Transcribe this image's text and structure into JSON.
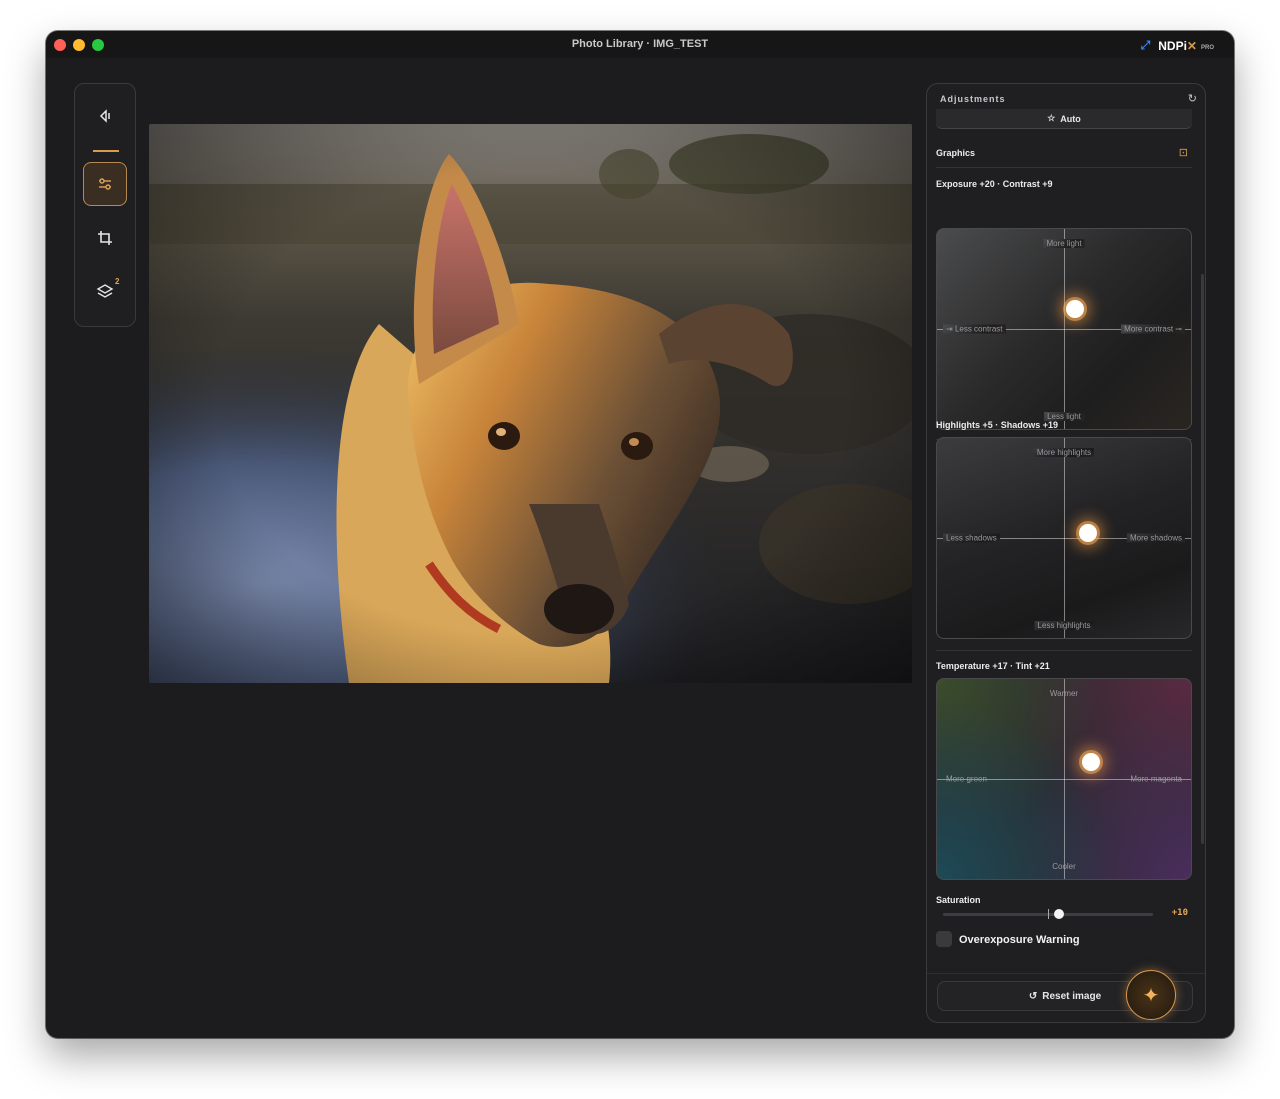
{
  "window": {
    "title": "Photo Library · IMG_TEST",
    "brand": "NDPi",
    "brand_x": "✕",
    "brand_badge": "PRO"
  },
  "toolbar": {
    "layers_badge": "2",
    "tools": [
      "back",
      "adjustments",
      "crop",
      "layers"
    ],
    "active_tool": "adjustments"
  },
  "adjustments": {
    "title": "Adjustments",
    "auto_label": "Auto",
    "graphics_label": "Graphics",
    "exposure": {
      "label": "Exposure +20 · Contrast +9",
      "top": "More light",
      "bottom": "Less light",
      "left": "Less contrast",
      "right": "More contrast",
      "exposure_value": 20,
      "contrast_value": 9
    },
    "highlights": {
      "label": "Highlights +5 · Shadows +19",
      "top": "More highlights",
      "bottom": "Less highlights",
      "left": "Less shadows",
      "right": "More shadows",
      "highlights_value": 5,
      "shadows_value": 19
    },
    "temperature": {
      "label": "Temperature +17 · Tint +21",
      "top": "Warmer",
      "bottom": "Cooler",
      "left": "More green",
      "right": "More magenta",
      "temperature_value": 17,
      "tint_value": 21
    },
    "saturation": {
      "label": "Saturation",
      "value_text": "+10",
      "value": 10,
      "range": [
        -100,
        100
      ]
    },
    "overexposure_label": "Overexposure Warning",
    "overexposure_checked": false,
    "reset_label": "Reset image"
  },
  "colors": {
    "accent": "#d89a4e",
    "value_accent": "#e7a85a"
  }
}
